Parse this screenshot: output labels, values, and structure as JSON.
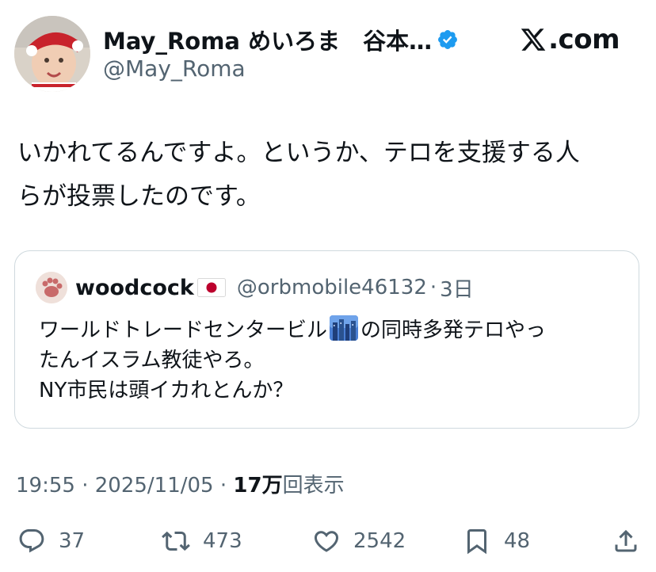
{
  "header": {
    "display_name": "May_Roma めいろま　谷本…",
    "handle": "@May_Roma",
    "brand": ".com"
  },
  "tweet": {
    "text_line1": "いかれてるんですよ。というか、テロを支援する人",
    "text_line2": "らが投票したのです。"
  },
  "quote": {
    "name": "woodcock",
    "handle": "@orbmobile46132",
    "separator": "·",
    "time": "3日",
    "line1_before_emoji": "ワールドトレードセンタービル",
    "line1_after_emoji": "の同時多発テロやっ",
    "line2": "たんイスラム教徒やろ。",
    "line3": "NY市民は頭イカれとんか？"
  },
  "meta": {
    "time": "19:55",
    "separator": "·",
    "date": "2025/11/05",
    "views_count": "17万",
    "views_label": "回表示"
  },
  "actions": {
    "replies": "37",
    "reposts": "473",
    "likes": "2542",
    "bookmarks": "48"
  },
  "icons": {
    "verified": "verified-badge-icon",
    "brand": "x-logo-icon",
    "flag": "japan-flag-icon",
    "emoji": "cityscape-icon",
    "reply": "reply-icon",
    "repost": "repost-icon",
    "like": "heart-icon",
    "bookmark": "bookmark-icon",
    "share": "share-icon"
  },
  "colors": {
    "text": "#0f1419",
    "secondary": "#536471",
    "verified": "#1d9bf0",
    "border": "#cfd9de",
    "flag_red": "#bc002d"
  }
}
